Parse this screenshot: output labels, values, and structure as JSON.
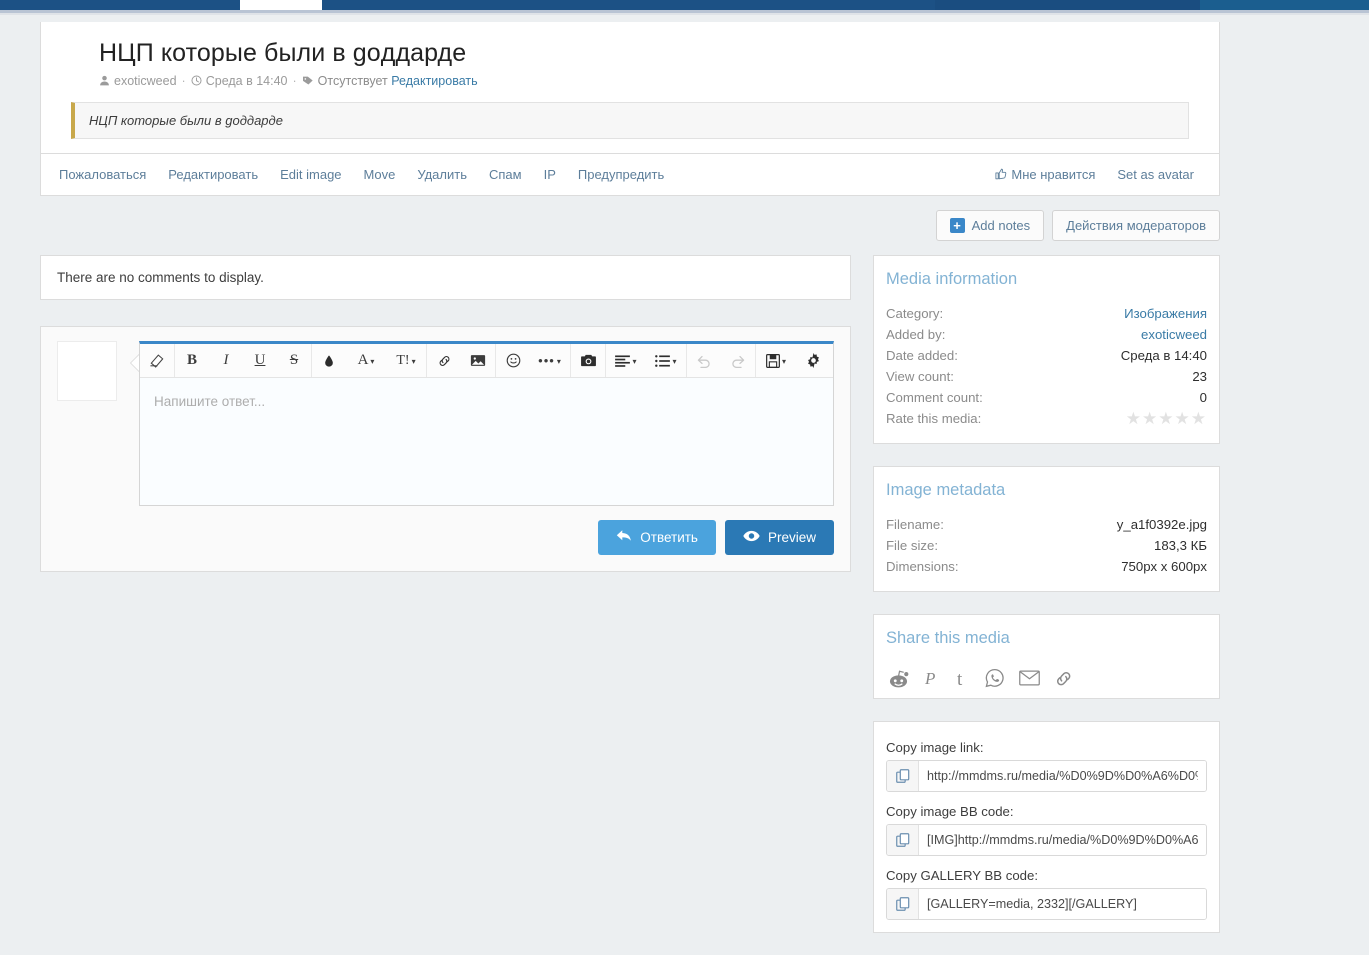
{
  "topnav": {
    "active_tab_label": ""
  },
  "media": {
    "title": "НЦП которые были в goддарде",
    "byline": {
      "author": "exoticweed",
      "date": "Среда в 14:40",
      "tag_label": "Отсутствует",
      "edit_link": "Редактировать",
      "sep": "·"
    },
    "description": "НЦП которые были в goддарде"
  },
  "actionbar": {
    "left_links": [
      "Пожаловаться",
      "Редактировать",
      "Edit image",
      "Move",
      "Удалить",
      "Спам",
      "IP",
      "Предупредить"
    ],
    "like_label": "Мне нравится",
    "set_avatar_label": "Set as avatar"
  },
  "notes": {
    "add_notes_label": "Add notes",
    "moderator_actions_label": "Действия модераторов"
  },
  "comments": {
    "empty_text": "There are no comments to display."
  },
  "editor": {
    "placeholder": "Напишите ответ...",
    "reply_label": "Ответить",
    "preview_label": "Preview",
    "toolbar": [
      {
        "name": "eraser-icon",
        "glyph": "◨"
      },
      {
        "name": "bold-icon",
        "glyph": "B"
      },
      {
        "name": "italic-icon",
        "glyph": "I"
      },
      {
        "name": "underline-icon",
        "glyph": "U"
      },
      {
        "name": "strikethrough-icon",
        "glyph": "S"
      },
      {
        "name": "text-color-icon",
        "glyph": "◆"
      },
      {
        "name": "font-family-icon",
        "glyph": "A"
      },
      {
        "name": "font-size-icon",
        "glyph": "T!"
      },
      {
        "name": "link-icon",
        "glyph": "🔗"
      },
      {
        "name": "image-icon",
        "glyph": "🖼"
      },
      {
        "name": "smilie-icon",
        "glyph": "☺"
      },
      {
        "name": "more-options-icon",
        "glyph": "•••"
      },
      {
        "name": "camera-icon",
        "glyph": "📷"
      },
      {
        "name": "align-icon",
        "glyph": "≡"
      },
      {
        "name": "list-icon",
        "glyph": "☰"
      },
      {
        "name": "undo-icon",
        "glyph": "↺"
      },
      {
        "name": "redo-icon",
        "glyph": "↻"
      },
      {
        "name": "draft-icon",
        "glyph": "💾"
      },
      {
        "name": "gear-icon",
        "glyph": "⚙"
      }
    ]
  },
  "media_information": {
    "heading": "Media information",
    "rows": [
      {
        "key": "Category:",
        "value": "Изображения",
        "link": true
      },
      {
        "key": "Added by:",
        "value": "exoticweed",
        "link": true
      },
      {
        "key": "Date added:",
        "value": "Среда в 14:40",
        "link": false
      },
      {
        "key": "View count:",
        "value": "23",
        "link": false
      },
      {
        "key": "Comment count:",
        "value": "0",
        "link": false
      }
    ],
    "rate_label": "Rate this media:",
    "rate_stars": "★★★★★"
  },
  "image_metadata": {
    "heading": "Image metadata",
    "rows": [
      {
        "key": "Filename:",
        "value": "y_a1f0392e.jpg"
      },
      {
        "key": "File size:",
        "value": "183,3 КБ"
      },
      {
        "key": "Dimensions:",
        "value": "750px x 600px"
      }
    ]
  },
  "share": {
    "heading": "Share this media",
    "icons": [
      {
        "name": "reddit-icon"
      },
      {
        "name": "pinterest-icon"
      },
      {
        "name": "tumblr-icon"
      },
      {
        "name": "whatsapp-icon"
      },
      {
        "name": "email-icon"
      },
      {
        "name": "link-icon"
      }
    ]
  },
  "copy": {
    "fields": [
      {
        "label": "Copy image link:",
        "value": "http://mmdms.ru/media/%D0%9D%D0%A6%D0%"
      },
      {
        "label": "Copy image BB code:",
        "value": "[IMG]http://mmdms.ru/media/%D0%9D%D0%A69"
      },
      {
        "label": "Copy GALLERY BB code:",
        "value": "[GALLERY=media, 2332][/GALLERY]"
      }
    ]
  },
  "colors": {
    "navbar": "#1c5185",
    "accent": "#3a87c8",
    "reply_button": "#4ba3dd",
    "preview_button": "#2b79b5",
    "panel_heading": "#83b3d4",
    "desc_border": "#c8a84b"
  }
}
